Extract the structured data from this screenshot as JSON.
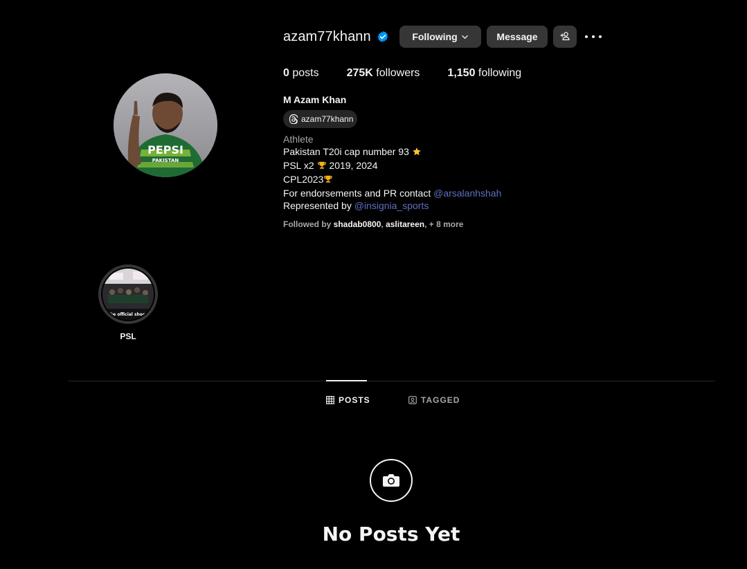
{
  "profile": {
    "username": "azam77khann",
    "verified": true,
    "full_name": "M Azam Khan",
    "threads_handle": "azam77khann"
  },
  "actions": {
    "following_label": "Following",
    "message_label": "Message"
  },
  "stats": {
    "posts_count": "0",
    "posts_label": " posts",
    "followers_count": "275K",
    "followers_label": " followers",
    "following_count": "1,150",
    "following_label": " following"
  },
  "bio": {
    "category": "Athlete",
    "line1": "Pakistan T20i cap number 93 ",
    "line2_a": "PSL x2 ",
    "line2_b": " 2019, 2024",
    "line3": "CPL2023",
    "line4_text": "For endorsements and PR contact ",
    "line4_mention": "@arsalanhshah",
    "line5_text": "Represented by ",
    "line5_mention": "@insignia_sports"
  },
  "followed_by": {
    "prefix": "Followed by ",
    "user1": "shadab0800",
    "sep": ", ",
    "user2": "aslitareen",
    "suffix": ", + 8 more"
  },
  "highlights": [
    {
      "label": "PSL",
      "cover_text": "The official shoot."
    }
  ],
  "tabs": {
    "posts": "POSTS",
    "tagged": "TAGGED",
    "active": "posts"
  },
  "empty_state": {
    "title": "No Posts Yet",
    "icon": "camera-icon"
  },
  "colors": {
    "background": "#000000",
    "button": "#363636",
    "mention": "#5e6fbf",
    "verified": "#0095f6",
    "secondary_text": "#a8a8a8"
  }
}
